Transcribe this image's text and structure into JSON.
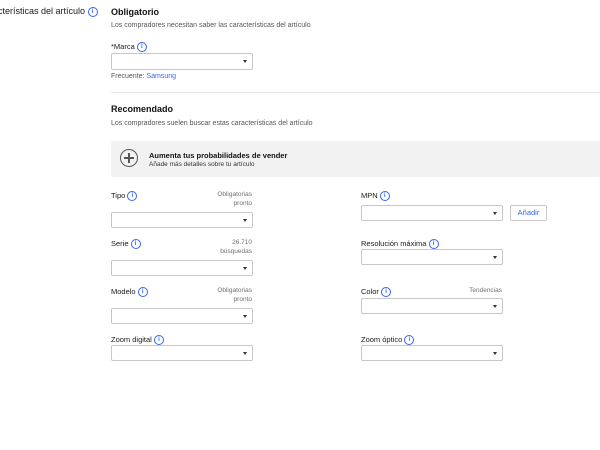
{
  "sidebar": {
    "section_label": "cterísticas del artículo"
  },
  "required": {
    "title": "Obligatorio",
    "subtitle": "Los compradores necesitan saber las características del artículo",
    "brand_label": "*Marca",
    "brand_value": "",
    "frequent_prefix": "Frecuente:",
    "frequent_value": "Samsung"
  },
  "recommended": {
    "title": "Recomendado",
    "subtitle": "Los compradores suelen buscar estas características del artículo",
    "banner_title": "Aumenta tus probabilidades de vender",
    "banner_subtitle": "Añade más detalles sobre tu artículo"
  },
  "fields": {
    "tipo": {
      "label": "Tipo",
      "hint_line1": "Obligatorias",
      "hint_line2": "pronto",
      "value": ""
    },
    "serie": {
      "label": "Serie",
      "hint_line1": "26.710",
      "hint_line2": "búsquedas",
      "value": ""
    },
    "modelo": {
      "label": "Modelo",
      "hint_line1": "Obligatorias",
      "hint_line2": "pronto",
      "value": ""
    },
    "zoom_digital": {
      "label": "Zoom digital",
      "value": ""
    },
    "mpn": {
      "label": "MPN",
      "value": "",
      "add_button": "Añadir"
    },
    "resolucion": {
      "label": "Resolución máxima",
      "value": ""
    },
    "color": {
      "label": "Color",
      "hint_line1": "Tendencias",
      "value": ""
    },
    "zoom_optico": {
      "label": "Zoom óptico",
      "value": ""
    }
  },
  "colors": {
    "accent": "#3665f3",
    "banner_bg": "#f2f2f2",
    "border": "#c7c7c7"
  }
}
